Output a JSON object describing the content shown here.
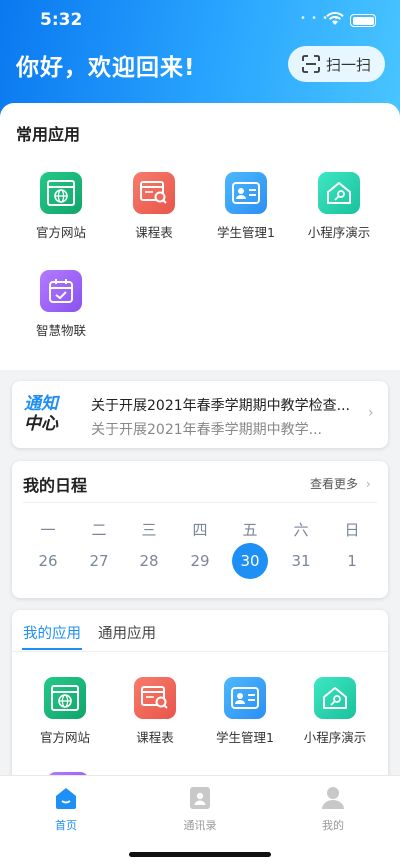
{
  "status_bar": {
    "time": "5:32"
  },
  "header": {
    "greeting": "你好，欢迎回来!",
    "scan_label": "扫一扫"
  },
  "common_apps": {
    "title": "常用应用",
    "items": [
      {
        "label": "官方网站",
        "icon": "globe-window-icon",
        "color": "#1cb87a"
      },
      {
        "label": "课程表",
        "icon": "schedule-search-icon",
        "color": "#ef6a5c"
      },
      {
        "label": "学生管理1",
        "icon": "id-card-icon",
        "color": "#3aa6f8"
      },
      {
        "label": "小程序演示",
        "icon": "house-key-icon",
        "color": "#2ad4b0"
      },
      {
        "label": "智慧物联",
        "icon": "calendar-check-icon",
        "color": "#a066f7"
      }
    ]
  },
  "notice": {
    "logo_line1": "通知",
    "logo_line2": "中心",
    "title": "关于开展2021年春季学期期中教学检查...",
    "subtitle": "关于开展2021年春季学期期中教学..."
  },
  "schedule": {
    "title": "我的日程",
    "more_label": "查看更多",
    "weekdays": [
      "一",
      "二",
      "三",
      "四",
      "五",
      "六",
      "日"
    ],
    "days": [
      "26",
      "27",
      "28",
      "29",
      "30",
      "31",
      "1"
    ],
    "selected_day": "30"
  },
  "my_apps": {
    "tabs": [
      {
        "label": "我的应用",
        "active": true
      },
      {
        "label": "通用应用",
        "active": false
      }
    ],
    "items": [
      {
        "label": "官方网站",
        "icon": "globe-window-icon"
      },
      {
        "label": "课程表",
        "icon": "schedule-search-icon"
      },
      {
        "label": "学生管理1",
        "icon": "id-card-icon"
      },
      {
        "label": "小程序演示",
        "icon": "house-key-icon"
      }
    ]
  },
  "tabbar": {
    "items": [
      {
        "label": "首页",
        "icon": "home-icon",
        "active": true
      },
      {
        "label": "通讯录",
        "icon": "contacts-icon",
        "active": false
      },
      {
        "label": "我的",
        "icon": "profile-icon",
        "active": false
      }
    ]
  },
  "colors": {
    "primary": "#1e90f5",
    "header_gradient_start": "#0a78f0",
    "header_gradient_end": "#49c5ff"
  }
}
